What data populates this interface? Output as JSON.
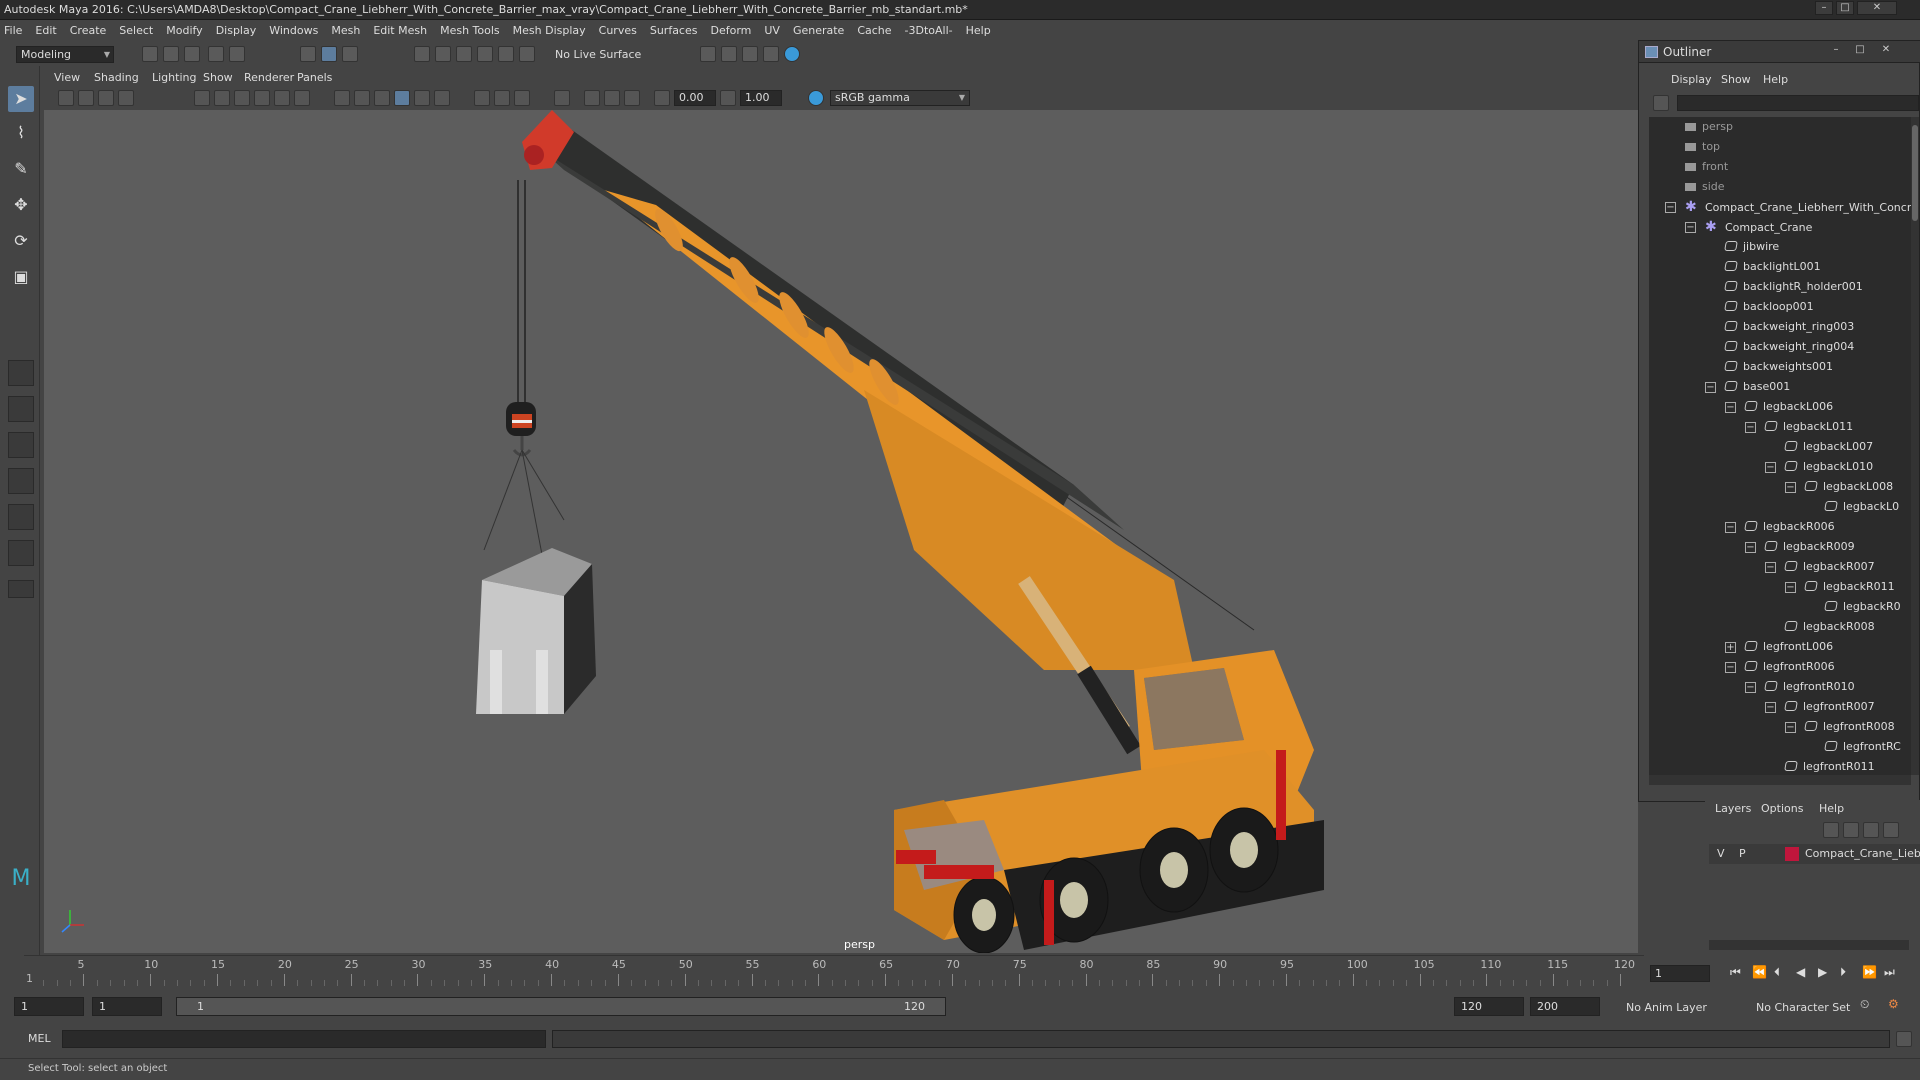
{
  "window": {
    "title": "Autodesk Maya 2016: C:\\Users\\AMDA8\\Desktop\\Compact_Crane_Liebherr_With_Concrete_Barrier_max_vray\\Compact_Crane_Liebherr_With_Concrete_Barrier_mb_standart.mb*"
  },
  "menubar": [
    "File",
    "Edit",
    "Create",
    "Select",
    "Modify",
    "Display",
    "Windows",
    "Mesh",
    "Edit Mesh",
    "Mesh Tools",
    "Mesh Display",
    "Curves",
    "Surfaces",
    "Deform",
    "UV",
    "Generate",
    "Cache",
    "-3DtoAll-",
    "Help"
  ],
  "statusline": {
    "mode": "Modeling",
    "live_surface": "No Live Surface"
  },
  "panel": {
    "menu": [
      "View",
      "Shading",
      "Lighting",
      "Show",
      "Renderer",
      "Panels"
    ],
    "exposure": "0.00",
    "gamma_value": "1.00",
    "color_space": "sRGB gamma",
    "camera_label": "persp"
  },
  "outliner": {
    "title": "Outliner",
    "menu": [
      "Display",
      "Show",
      "Help"
    ],
    "items": [
      {
        "label": "persp",
        "kind": "camera",
        "depth": 0
      },
      {
        "label": "top",
        "kind": "camera",
        "depth": 0
      },
      {
        "label": "front",
        "kind": "camera",
        "depth": 0
      },
      {
        "label": "side",
        "kind": "camera",
        "depth": 0
      },
      {
        "label": "Compact_Crane_Liebherr_With_Concr",
        "kind": "group",
        "depth": 0,
        "exp": "−"
      },
      {
        "label": "Compact_Crane",
        "kind": "group",
        "depth": 1,
        "exp": "−"
      },
      {
        "label": "jibwire",
        "kind": "mesh",
        "depth": 2
      },
      {
        "label": "backlightL001",
        "kind": "mesh",
        "depth": 2
      },
      {
        "label": "backlightR_holder001",
        "kind": "mesh",
        "depth": 2
      },
      {
        "label": "backloop001",
        "kind": "mesh",
        "depth": 2
      },
      {
        "label": "backweight_ring003",
        "kind": "mesh",
        "depth": 2
      },
      {
        "label": "backweight_ring004",
        "kind": "mesh",
        "depth": 2
      },
      {
        "label": "backweights001",
        "kind": "mesh",
        "depth": 2
      },
      {
        "label": "base001",
        "kind": "mesh",
        "depth": 2,
        "exp": "−"
      },
      {
        "label": "legbackL006",
        "kind": "mesh",
        "depth": 3,
        "exp": "−"
      },
      {
        "label": "legbackL011",
        "kind": "mesh",
        "depth": 4,
        "exp": "−"
      },
      {
        "label": "legbackL007",
        "kind": "mesh",
        "depth": 5
      },
      {
        "label": "legbackL010",
        "kind": "mesh",
        "depth": 5,
        "exp": "−"
      },
      {
        "label": "legbackL008",
        "kind": "mesh",
        "depth": 6,
        "exp": "−"
      },
      {
        "label": "legbackL0",
        "kind": "mesh",
        "depth": 7
      },
      {
        "label": "legbackR006",
        "kind": "mesh",
        "depth": 3,
        "exp": "−"
      },
      {
        "label": "legbackR009",
        "kind": "mesh",
        "depth": 4,
        "exp": "−"
      },
      {
        "label": "legbackR007",
        "kind": "mesh",
        "depth": 5,
        "exp": "−"
      },
      {
        "label": "legbackR011",
        "kind": "mesh",
        "depth": 6,
        "exp": "−"
      },
      {
        "label": "legbackR0",
        "kind": "mesh",
        "depth": 7
      },
      {
        "label": "legbackR008",
        "kind": "mesh",
        "depth": 5
      },
      {
        "label": "legfrontL006",
        "kind": "mesh",
        "depth": 3,
        "exp": "+"
      },
      {
        "label": "legfrontR006",
        "kind": "mesh",
        "depth": 3,
        "exp": "−"
      },
      {
        "label": "legfrontR010",
        "kind": "mesh",
        "depth": 4,
        "exp": "−"
      },
      {
        "label": "legfrontR007",
        "kind": "mesh",
        "depth": 5,
        "exp": "−"
      },
      {
        "label": "legfrontR008",
        "kind": "mesh",
        "depth": 6,
        "exp": "−"
      },
      {
        "label": "legfrontRC",
        "kind": "mesh",
        "depth": 7
      },
      {
        "label": "legfrontR011",
        "kind": "mesh",
        "depth": 5
      }
    ]
  },
  "layers": {
    "menu": [
      "Layers",
      "Options",
      "Help"
    ],
    "row": {
      "v": "V",
      "p": "P",
      "name": "Compact_Crane_Liebh",
      "color": "#c0163c"
    }
  },
  "timeline": {
    "ticks": [
      5,
      10,
      15,
      20,
      25,
      30,
      35,
      40,
      45,
      50,
      55,
      60,
      65,
      70,
      75,
      80,
      85,
      90,
      95,
      100,
      105,
      110,
      115,
      120
    ],
    "start_marker": "1",
    "current_frame": "1"
  },
  "range": {
    "start": "1",
    "playback_start": "1",
    "bar_start": "1",
    "bar_end": "120",
    "playback_end": "120",
    "end": "200",
    "anim_layer": "No Anim Layer",
    "char_set": "No Character Set"
  },
  "cmdline": {
    "lang": "MEL"
  },
  "helpline": {
    "text": "Select Tool: select an object"
  }
}
